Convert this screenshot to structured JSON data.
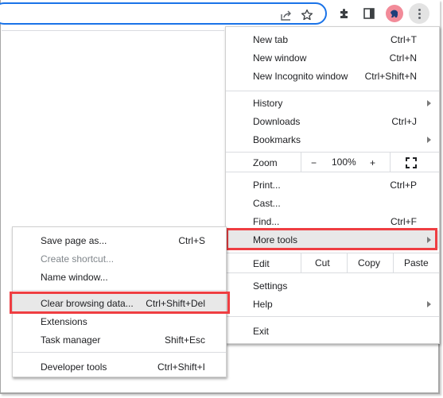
{
  "toolbar": {
    "icons": [
      "share-icon",
      "bookmark-star-icon",
      "extensions-puzzle-icon",
      "side-panel-icon",
      "profile-avatar",
      "kebab-menu-icon"
    ],
    "accent_color": "#1a73e8",
    "avatar_color": "#f28b99"
  },
  "main_menu": {
    "new_tab": {
      "label": "New tab",
      "shortcut": "Ctrl+T"
    },
    "new_window": {
      "label": "New window",
      "shortcut": "Ctrl+N"
    },
    "new_incognito": {
      "label": "New Incognito window",
      "shortcut": "Ctrl+Shift+N"
    },
    "history": {
      "label": "History"
    },
    "downloads": {
      "label": "Downloads",
      "shortcut": "Ctrl+J"
    },
    "bookmarks": {
      "label": "Bookmarks"
    },
    "zoom": {
      "label": "Zoom",
      "minus": "−",
      "value": "100%",
      "plus": "+"
    },
    "print": {
      "label": "Print...",
      "shortcut": "Ctrl+P"
    },
    "cast": {
      "label": "Cast..."
    },
    "find": {
      "label": "Find...",
      "shortcut": "Ctrl+F"
    },
    "more_tools": {
      "label": "More tools"
    },
    "edit": {
      "label": "Edit",
      "cut": "Cut",
      "copy": "Copy",
      "paste": "Paste"
    },
    "settings": {
      "label": "Settings"
    },
    "help": {
      "label": "Help"
    },
    "exit": {
      "label": "Exit"
    }
  },
  "more_tools_menu": {
    "save_page": {
      "label": "Save page as...",
      "shortcut": "Ctrl+S"
    },
    "create_shortcut": {
      "label": "Create shortcut..."
    },
    "name_window": {
      "label": "Name window..."
    },
    "clear_browsing": {
      "label": "Clear browsing data...",
      "shortcut": "Ctrl+Shift+Del"
    },
    "extensions": {
      "label": "Extensions"
    },
    "task_manager": {
      "label": "Task manager",
      "shortcut": "Shift+Esc"
    },
    "developer_tools": {
      "label": "Developer tools",
      "shortcut": "Ctrl+Shift+I"
    }
  },
  "annotation": {
    "highlight_color": "#ef3e42"
  }
}
